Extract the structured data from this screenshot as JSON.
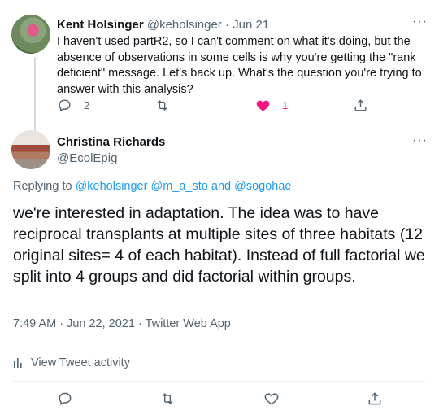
{
  "tweet1": {
    "name": "Kent Holsinger",
    "handle": "@keholsinger",
    "separator": "·",
    "date": "Jun 21",
    "more": "···",
    "text": "I haven't used partR2, so I can't comment on what it's doing, but the absence of observations in some cells is why you're getting the \"rank deficient\" message. Let's back up. What's the question you're trying to answer with this analysis?",
    "reply_count": "2",
    "like_count": "1",
    "colors": {
      "like": "#f91880",
      "icon": "#536471"
    }
  },
  "tweet2": {
    "name": "Christina Richards",
    "handle": "@EcolEpig",
    "more": "···",
    "replying_prefix": "Replying to",
    "replying_users": [
      "@keholsinger",
      "@m_a_sto",
      "@sogohae"
    ],
    "replying_and": "and",
    "text": "we're interested in adaptation. The idea was to have reciprocal transplants at multiple sites of three habitats (12 original sites= 4 of each habitat). Instead of full factorial we split into 4 groups and did factorial within groups.",
    "timestamp": "7:49 AM · Jun 22, 2021 · Twitter Web App",
    "activity_label": "View Tweet activity"
  },
  "colors": {
    "link": "#1d9bf0",
    "secondary_text": "#536471",
    "primary_text": "#0f1419"
  }
}
